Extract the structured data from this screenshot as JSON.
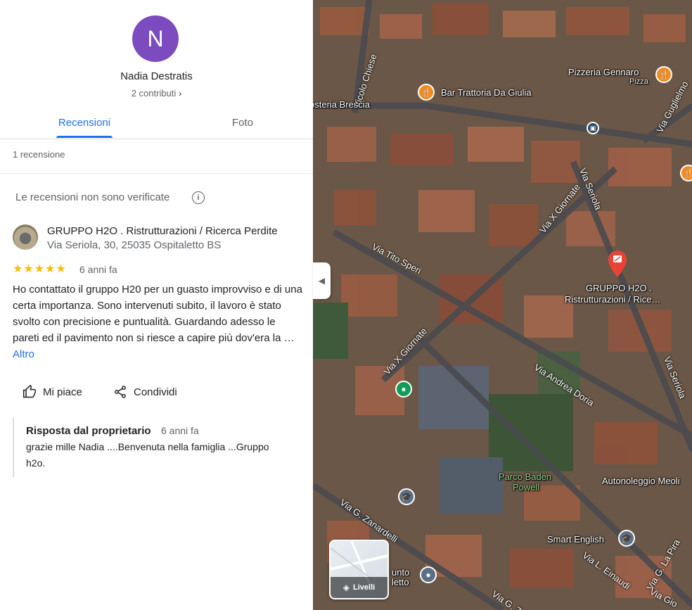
{
  "profile": {
    "initial": "N",
    "name": "Nadia Destratis",
    "contributions": "2 contributi"
  },
  "tabs": {
    "reviews": "Recensioni",
    "photos": "Foto"
  },
  "review_count": "1 recensione",
  "unverified_note": "Le recensioni non sono verificate",
  "review": {
    "business_name": "GRUPPO H2O . Ristrutturazioni / Ricerca Perdite",
    "address": "Via Seriola, 30, 25035 Ospitaletto BS",
    "rating": 5,
    "date": "6 anni fa",
    "text": "Ho contattato il gruppo H20 per un guasto improvviso e di una certa importanza. Sono intervenuti subito, il lavoro è stato svolto con precisione e puntualità. Guardando adesso le pareti ed il pavimento non si riesce a capire più dov'era la …",
    "more": "Altro",
    "like_label": "Mi piace",
    "share_label": "Condividi"
  },
  "owner_reply": {
    "heading": "Risposta dal proprietario",
    "date": "6 anni fa",
    "text": "grazie mille Nadia ....Benvenuta nella famiglia ...Gruppo h2o."
  },
  "map": {
    "places": {
      "pizzeria": "Pizzeria Gennaro",
      "pizzeria_sub": "Pizza",
      "trattoria": "Bar Trattoria Da Giulia",
      "osteria": "osteria Brescia",
      "selected_line1": "GRUPPO H2O .",
      "selected_line2": "Ristrutturazioni / Rice…",
      "park_line1": "Parco Baden",
      "park_line2": "Powell",
      "autonoleggio": "Autonoleggio Meoli",
      "smart_english": "Smart English",
      "punto_line1": "unto",
      "punto_line2": "letto"
    },
    "streets": {
      "vicolo_chiese": "Vicolo Chiese",
      "via_tito_speri": "Via Tito Speri",
      "via_x_giornate_1": "Via X Giornate",
      "via_x_giornate_2": "Via X Giornate",
      "via_seriola_1": "Via Seriola",
      "via_seriola_2": "Via Seriola",
      "via_andrea_doria": "Via Andrea Doria",
      "via_zanardelli": "Via G. Zanardelli",
      "via_einaudi": "Via L. Einaudi",
      "via_la_pira": "Via G. La Pira",
      "via_guglielmo": "Via Guglielmo",
      "via_gio": "Via Gio",
      "via_g_za": "Via G. Za"
    },
    "layers_label": "Livelli"
  },
  "colors": {
    "accent": "#1a73e8",
    "avatar": "#7b4bbf",
    "star": "#fbbc04",
    "food_pin": "#f28b20",
    "selected_pin": "#ea4335"
  }
}
